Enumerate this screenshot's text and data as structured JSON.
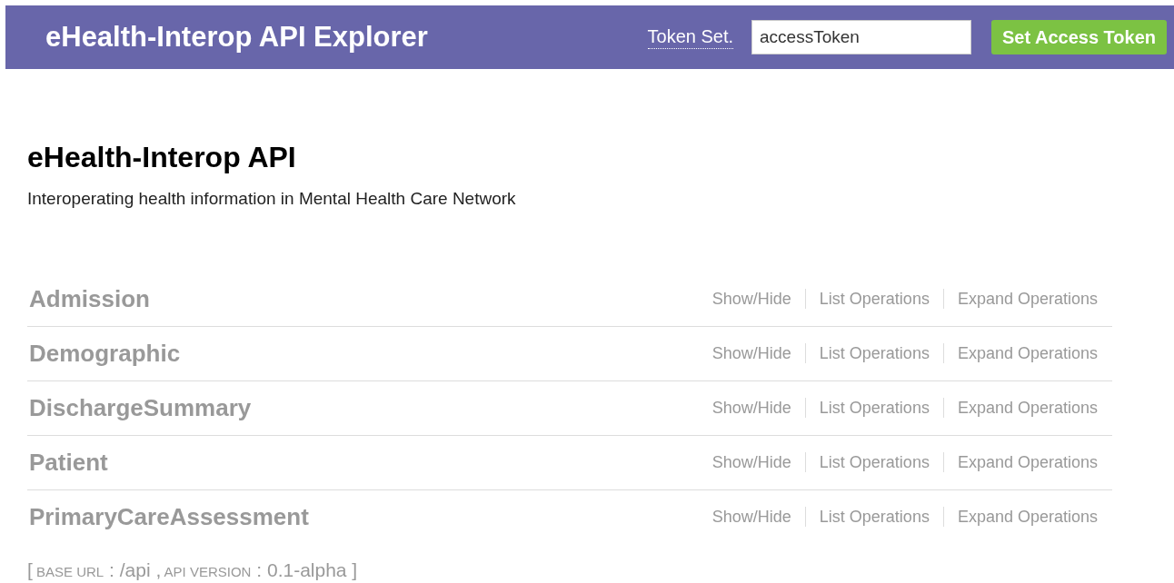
{
  "header": {
    "title": "eHealth-Interop API Explorer",
    "token_label": "Token Set.",
    "token_field": {
      "value": "accessToken"
    },
    "button": "Set Access Token"
  },
  "info": {
    "title": "eHealth-Interop API",
    "description": "Interoperating health information in Mental Health Care Network"
  },
  "resources": [
    {
      "name": "Admission",
      "actions": [
        "Show/Hide",
        "List Operations",
        "Expand Operations"
      ]
    },
    {
      "name": "Demographic",
      "actions": [
        "Show/Hide",
        "List Operations",
        "Expand Operations"
      ]
    },
    {
      "name": "DischargeSummary",
      "actions": [
        "Show/Hide",
        "List Operations",
        "Expand Operations"
      ]
    },
    {
      "name": "Patient",
      "actions": [
        "Show/Hide",
        "List Operations",
        "Expand Operations"
      ]
    },
    {
      "name": "PrimaryCareAssessment",
      "actions": [
        "Show/Hide",
        "List Operations",
        "Expand Operations"
      ]
    }
  ],
  "footer": {
    "parts": [
      {
        "kind": "value",
        "text": "["
      },
      {
        "kind": "label",
        "text": "BASE URL"
      },
      {
        "kind": "value",
        "text": ": /api ,"
      },
      {
        "kind": "label",
        "text": "API VERSION"
      },
      {
        "kind": "value",
        "text": ": 0.1-alpha ]"
      }
    ]
  }
}
